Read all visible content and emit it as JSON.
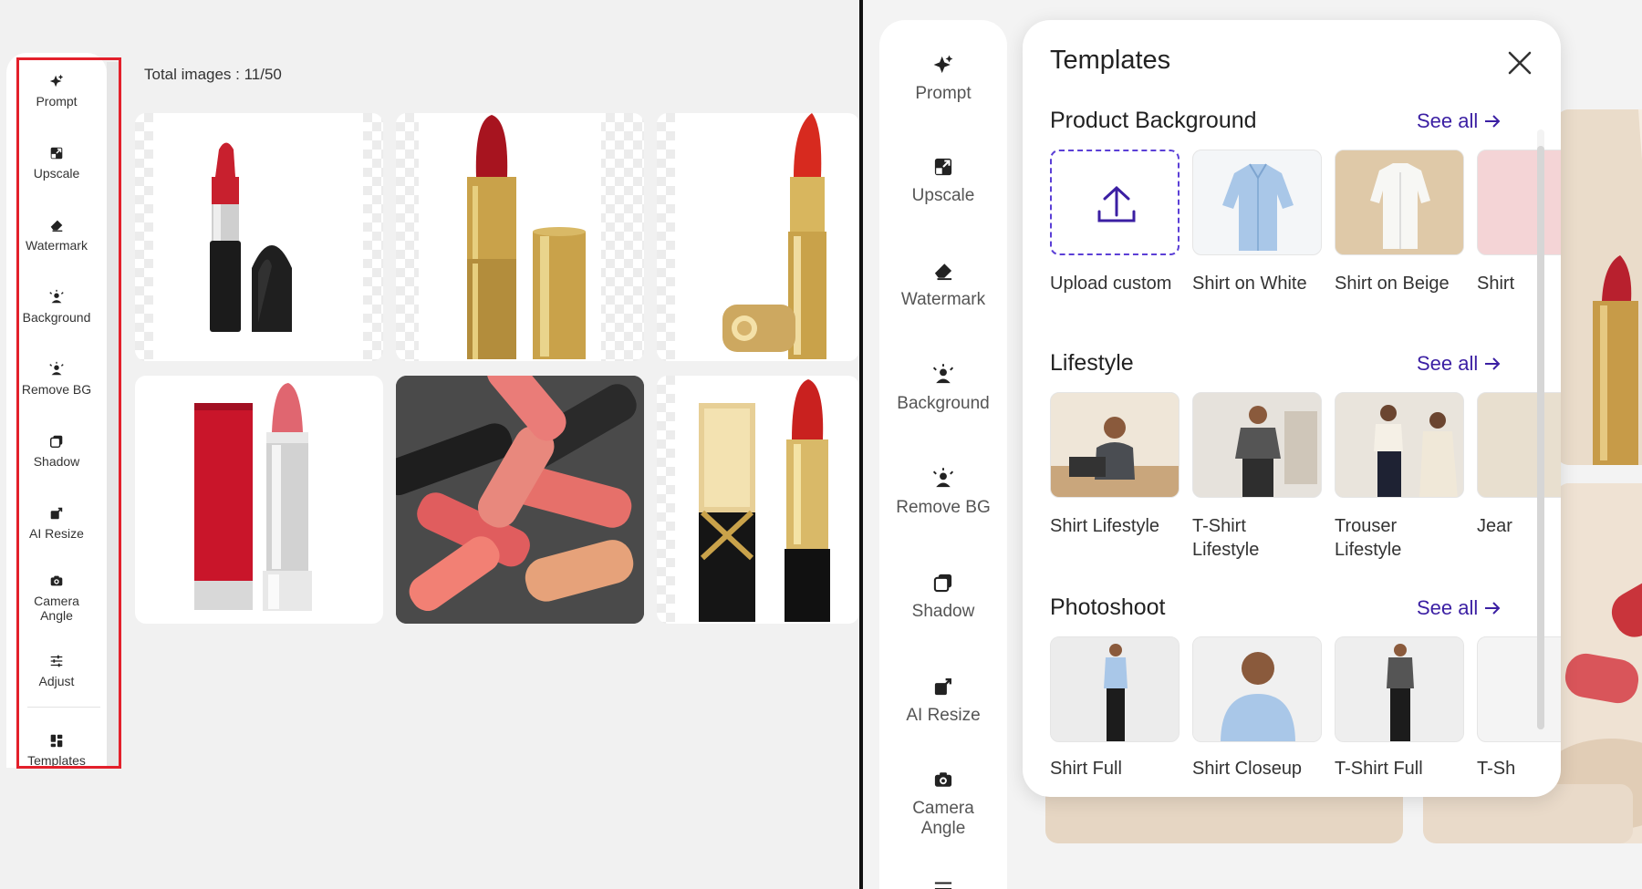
{
  "left": {
    "total_images": "Total images : 11/50",
    "sidebar": [
      {
        "label": "Prompt",
        "icon": "sparkle-icon"
      },
      {
        "label": "Upscale",
        "icon": "upscale-icon"
      },
      {
        "label": "Watermark",
        "icon": "eraser-icon"
      },
      {
        "label": "Background",
        "icon": "background-icon"
      },
      {
        "label": "Remove BG",
        "icon": "remove-bg-icon"
      },
      {
        "label": "Shadow",
        "icon": "shadow-icon"
      },
      {
        "label": "AI Resize",
        "icon": "resize-icon"
      },
      {
        "label": "Camera Angle",
        "icon": "camera-icon"
      },
      {
        "label": "Adjust",
        "icon": "sliders-icon"
      },
      {
        "label": "Templates",
        "icon": "templates-icon"
      }
    ],
    "highlight_color": "#e3202b"
  },
  "right": {
    "sidebar": [
      {
        "label": "Prompt",
        "icon": "sparkle-icon"
      },
      {
        "label": "Upscale",
        "icon": "upscale-icon"
      },
      {
        "label": "Watermark",
        "icon": "eraser-icon"
      },
      {
        "label": "Background",
        "icon": "background-icon"
      },
      {
        "label": "Remove BG",
        "icon": "remove-bg-icon"
      },
      {
        "label": "Shadow",
        "icon": "shadow-icon"
      },
      {
        "label": "AI Resize",
        "icon": "resize-icon"
      },
      {
        "label": "Camera Angle",
        "icon": "camera-icon"
      }
    ],
    "templates": {
      "title": "Templates",
      "accent": "#3b1fa3",
      "sections": [
        {
          "title": "Product Background",
          "see_all": "See all",
          "items": [
            "Upload custom",
            "Shirt on White",
            "Shirt on Beige",
            "Shirt"
          ]
        },
        {
          "title": "Lifestyle",
          "see_all": "See all",
          "items": [
            "Shirt Lifestyle",
            "T-Shirt Lifestyle",
            "Trouser Lifestyle",
            "Jear"
          ]
        },
        {
          "title": "Photoshoot",
          "see_all": "See all",
          "items": [
            "Shirt Full",
            "Shirt Closeup",
            "T-Shirt Full",
            "T-Sh"
          ]
        }
      ]
    }
  }
}
